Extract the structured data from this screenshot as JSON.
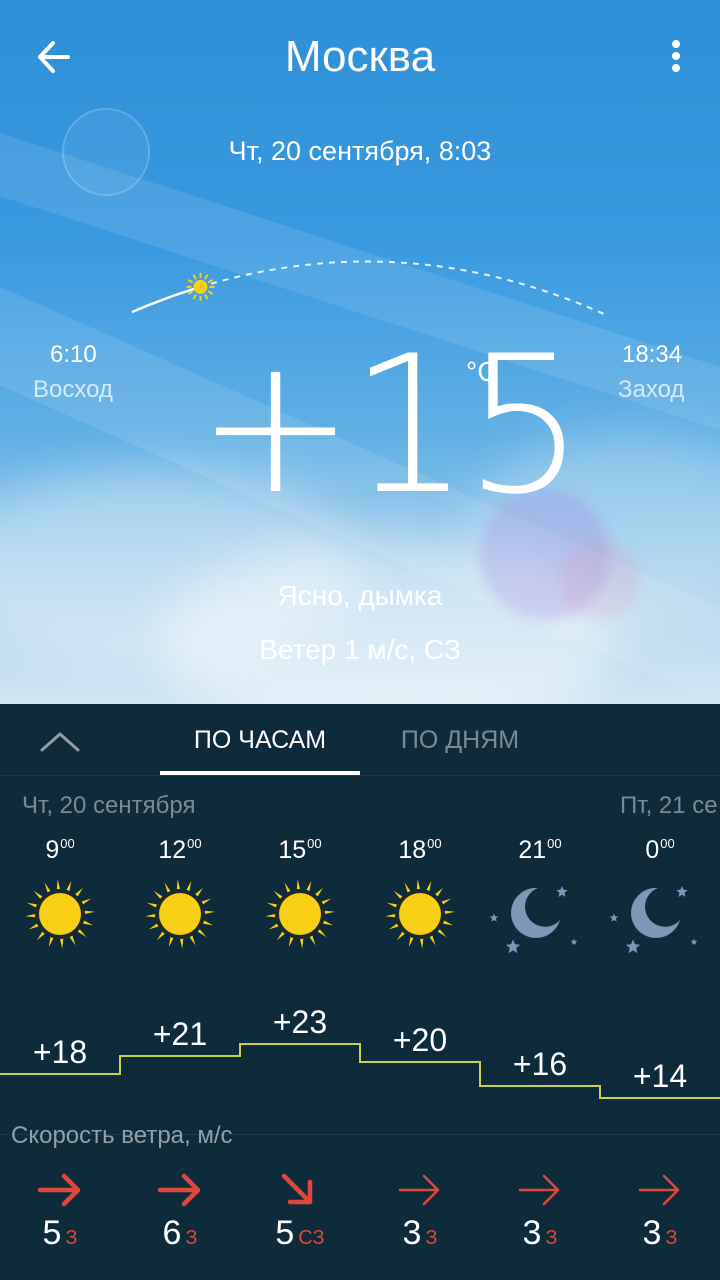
{
  "header": {
    "title": "Москва"
  },
  "current": {
    "datetime": "Чт, 20 сентября, 8:03",
    "sunrise_time": "6:10",
    "sunrise_label": "Восход",
    "sunset_time": "18:34",
    "sunset_label": "Заход",
    "temperature": "+15",
    "unit": "°C",
    "condition": "Ясно, дымка",
    "wind": "Ветер 1 м/с, СЗ",
    "sun_progress": 0.15
  },
  "tabs": {
    "hourly": "ПО ЧАСАМ",
    "daily": "ПО ДНЯМ",
    "active": "hourly"
  },
  "days": {
    "day1": "Чт, 20 сентября",
    "day2": "Пт, 21 се"
  },
  "hours": [
    {
      "hour": "9",
      "min": "00",
      "icon": "sun-icon",
      "temp": "+18",
      "t": 18,
      "wind_speed": "5",
      "wind_dir": "З",
      "arrow": "right",
      "arrow_strength": "strong"
    },
    {
      "hour": "12",
      "min": "00",
      "icon": "sun-icon",
      "temp": "+21",
      "t": 21,
      "wind_speed": "6",
      "wind_dir": "З",
      "arrow": "right",
      "arrow_strength": "strong"
    },
    {
      "hour": "15",
      "min": "00",
      "icon": "sun-icon",
      "temp": "+23",
      "t": 23,
      "wind_speed": "5",
      "wind_dir": "СЗ",
      "arrow": "down-right",
      "arrow_strength": "strong"
    },
    {
      "hour": "18",
      "min": "00",
      "icon": "sun-icon",
      "temp": "+20",
      "t": 20,
      "wind_speed": "3",
      "wind_dir": "З",
      "arrow": "right",
      "arrow_strength": "light"
    },
    {
      "hour": "21",
      "min": "00",
      "icon": "moon-icon",
      "temp": "+16",
      "t": 16,
      "wind_speed": "3",
      "wind_dir": "З",
      "arrow": "right",
      "arrow_strength": "light"
    },
    {
      "hour": "0",
      "min": "00",
      "icon": "moon-icon",
      "temp": "+14",
      "t": 14,
      "wind_speed": "3",
      "wind_dir": "З",
      "arrow": "right",
      "arrow_strength": "light"
    }
  ],
  "wind_section_title": "Скорость ветра, м/с",
  "colors": {
    "temp_line": "#c9d146",
    "wind_arrow": "#e0463a",
    "sun": "#f7cf14",
    "moon": "#7c97b8"
  }
}
